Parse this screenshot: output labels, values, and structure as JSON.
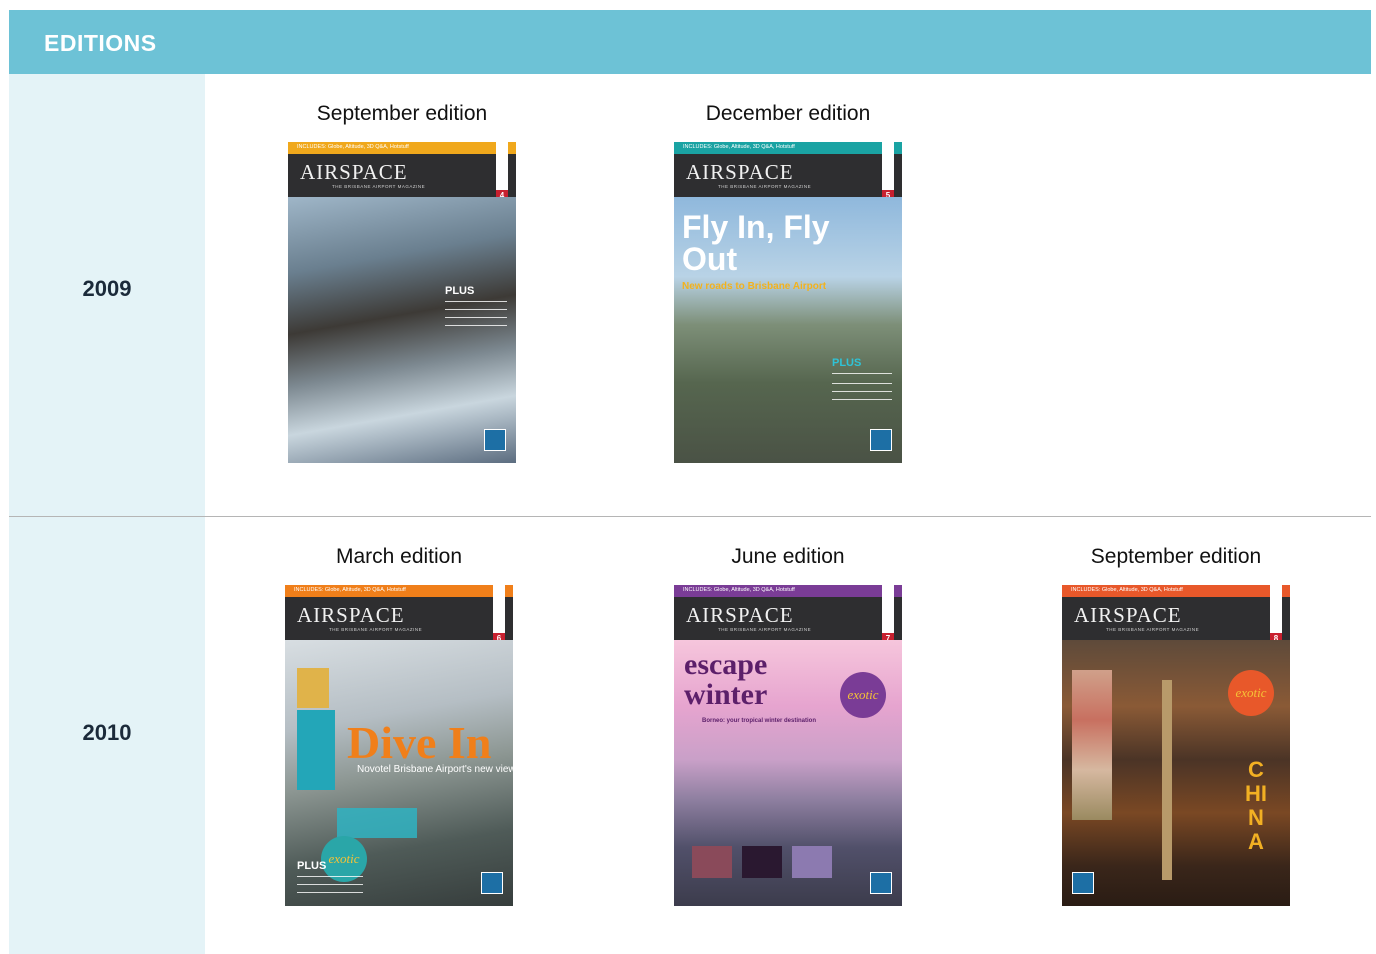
{
  "header": {
    "title": "EDITIONS"
  },
  "colors": {
    "header": "#6dc2d6",
    "year_column": "#e4f3f7"
  },
  "rows": [
    {
      "year": "2009",
      "editions": [
        {
          "label": "September edition",
          "cover": {
            "includes": "INCLUDES: Globe, Altitude, 3D Q&A, Hotstuff",
            "masthead": "AIRSPACE",
            "tagline": "THE BRISBANE AIRPORT MAGAZINE",
            "issue": "4",
            "plus": "PLUS",
            "accent": "#f0a81c"
          }
        },
        {
          "label": "December edition",
          "cover": {
            "includes": "INCLUDES: Globe, Altitude, 3D Q&A, Hotstuff",
            "masthead": "AIRSPACE",
            "tagline": "THE BRISBANE AIRPORT MAGAZINE",
            "issue": "5",
            "headline": "Fly In, Fly Out",
            "subheadline": "New roads to Brisbane Airport",
            "plus": "PLUS",
            "accent": "#1aa3a3"
          }
        }
      ]
    },
    {
      "year": "2010",
      "editions": [
        {
          "label": "March edition",
          "cover": {
            "includes": "INCLUDES: Globe, Altitude, 3D Q&A, Hotstuff",
            "masthead": "AIRSPACE",
            "tagline": "THE BRISBANE AIRPORT MAGAZINE",
            "issue": "6",
            "headline": "Dive In",
            "subheadline": "Novotel Brisbane Airport's new view",
            "plus": "PLUS",
            "stamp": "exotic",
            "accent": "#f07f1a"
          }
        },
        {
          "label": "June edition",
          "cover": {
            "includes": "INCLUDES: Globe, Altitude, 3D Q&A, Hotstuff",
            "masthead": "AIRSPACE",
            "tagline": "THE BRISBANE AIRPORT MAGAZINE",
            "issue": "7",
            "headline": "escape winter",
            "subheadline": "Borneo: your tropical winter destination",
            "stamp": "exotic",
            "accent": "#7a3c96"
          }
        },
        {
          "label": "September edition",
          "cover": {
            "includes": "INCLUDES: Globe, Altitude, 3D Q&A, Hotstuff",
            "masthead": "AIRSPACE",
            "tagline": "THE BRISBANE AIRPORT MAGAZINE",
            "issue": "8",
            "headline": "CHINA",
            "stamp": "exotic",
            "accent": "#e8582a"
          }
        }
      ]
    }
  ]
}
